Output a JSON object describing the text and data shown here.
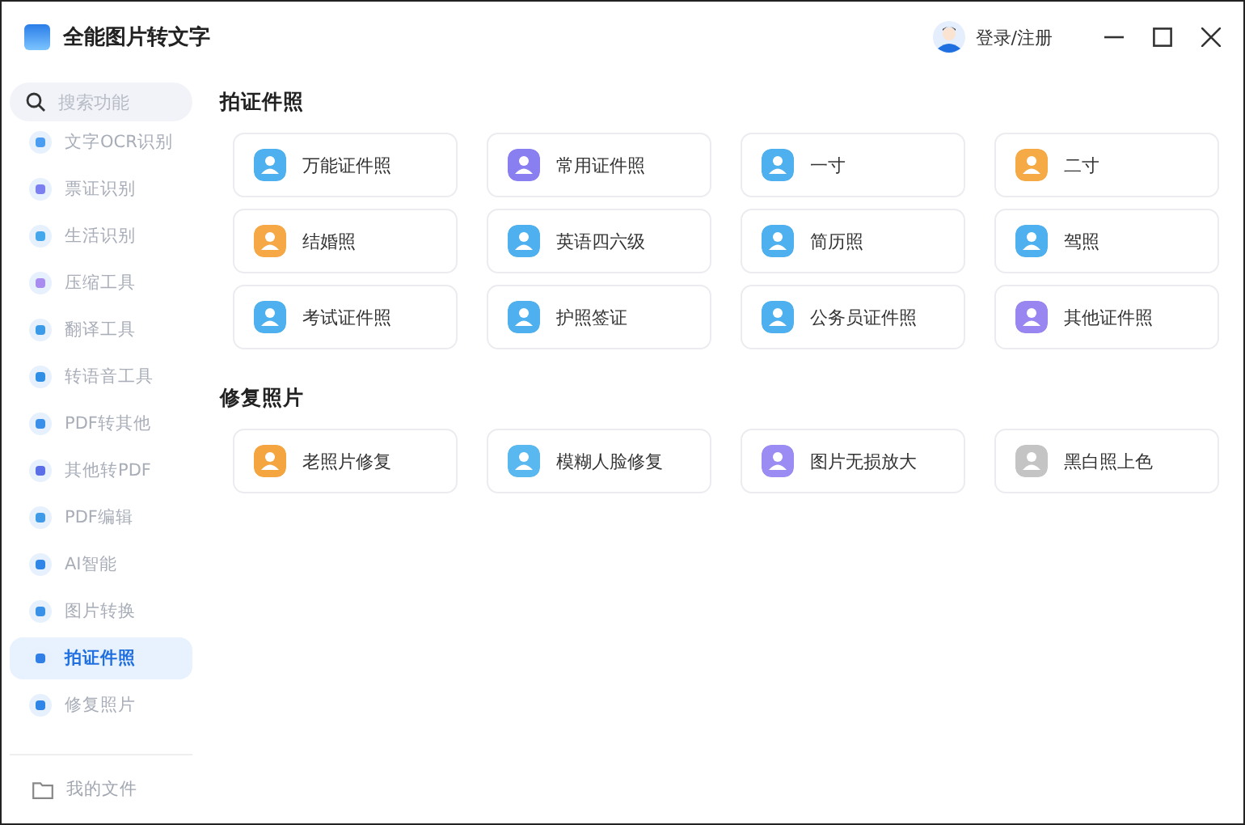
{
  "window": {
    "title": "全能图片转文字"
  },
  "account": {
    "label": "登录/注册"
  },
  "search": {
    "placeholder": "搜索功能"
  },
  "sidebar": {
    "items": [
      {
        "label": "文字OCR识别",
        "selected": false,
        "color": "#4a9df0"
      },
      {
        "label": "票证识别",
        "selected": false,
        "color": "#7b7ff0"
      },
      {
        "label": "生活识别",
        "selected": false,
        "color": "#46a8ec"
      },
      {
        "label": "压缩工具",
        "selected": false,
        "color": "#a98cf0"
      },
      {
        "label": "翻译工具",
        "selected": false,
        "color": "#3c9be8"
      },
      {
        "label": "转语音工具",
        "selected": false,
        "color": "#2f8fe6"
      },
      {
        "label": "PDF转其他",
        "selected": false,
        "color": "#3a8fe8"
      },
      {
        "label": "其他转PDF",
        "selected": false,
        "color": "#5a6ee8"
      },
      {
        "label": "PDF编辑",
        "selected": false,
        "color": "#3f9ae8"
      },
      {
        "label": "AI智能",
        "selected": false,
        "color": "#2f86e6"
      },
      {
        "label": "图片转换",
        "selected": false,
        "color": "#3a92e8"
      },
      {
        "label": "拍证件照",
        "selected": true,
        "color": "#2f7fe6"
      },
      {
        "label": "修复照片",
        "selected": false,
        "color": "#2f86e6"
      }
    ],
    "footer": "我的文件"
  },
  "sections": [
    {
      "title": "拍证件照",
      "tools": [
        {
          "label": "万能证件照",
          "color": "#4fb0f0"
        },
        {
          "label": "常用证件照",
          "color": "#8a7ff0"
        },
        {
          "label": "一寸",
          "color": "#4fb0f0"
        },
        {
          "label": "二寸",
          "color": "#f5aa45"
        },
        {
          "label": "结婚照",
          "color": "#f5a845"
        },
        {
          "label": "英语四六级",
          "color": "#4fb0f0"
        },
        {
          "label": "简历照",
          "color": "#4fb0f0"
        },
        {
          "label": "驾照",
          "color": "#4fb0f0"
        },
        {
          "label": "考试证件照",
          "color": "#4fb0f0"
        },
        {
          "label": "护照签证",
          "color": "#4fb0f0"
        },
        {
          "label": "公务员证件照",
          "color": "#4fb0f0"
        },
        {
          "label": "其他证件照",
          "color": "#9a86f0"
        }
      ]
    },
    {
      "title": "修复照片",
      "tools": [
        {
          "label": "老照片修复",
          "color": "#f5a540"
        },
        {
          "label": "模糊人脸修复",
          "color": "#5ab8f0"
        },
        {
          "label": "图片无损放大",
          "color": "#9a8cf2"
        },
        {
          "label": "黑白照上色",
          "color": "#c4c4c4"
        }
      ]
    }
  ]
}
